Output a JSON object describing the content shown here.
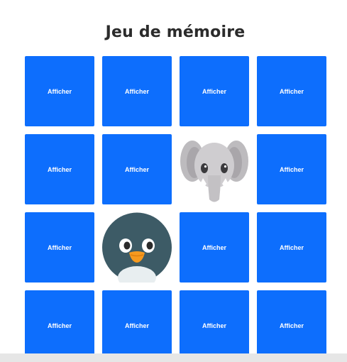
{
  "title": "Jeu de mémoire",
  "card_button_label": "Afficher",
  "colors": {
    "card_back": "#0d6efd",
    "card_label": "#ffffff",
    "title": "#2b2b2b"
  },
  "cards": [
    {
      "state": "hidden"
    },
    {
      "state": "hidden"
    },
    {
      "state": "hidden"
    },
    {
      "state": "hidden"
    },
    {
      "state": "hidden"
    },
    {
      "state": "hidden"
    },
    {
      "state": "revealed",
      "icon": "elephant-icon"
    },
    {
      "state": "hidden"
    },
    {
      "state": "hidden"
    },
    {
      "state": "revealed",
      "icon": "penguin-icon"
    },
    {
      "state": "hidden"
    },
    {
      "state": "hidden"
    },
    {
      "state": "hidden"
    },
    {
      "state": "hidden"
    },
    {
      "state": "hidden"
    },
    {
      "state": "hidden"
    }
  ]
}
